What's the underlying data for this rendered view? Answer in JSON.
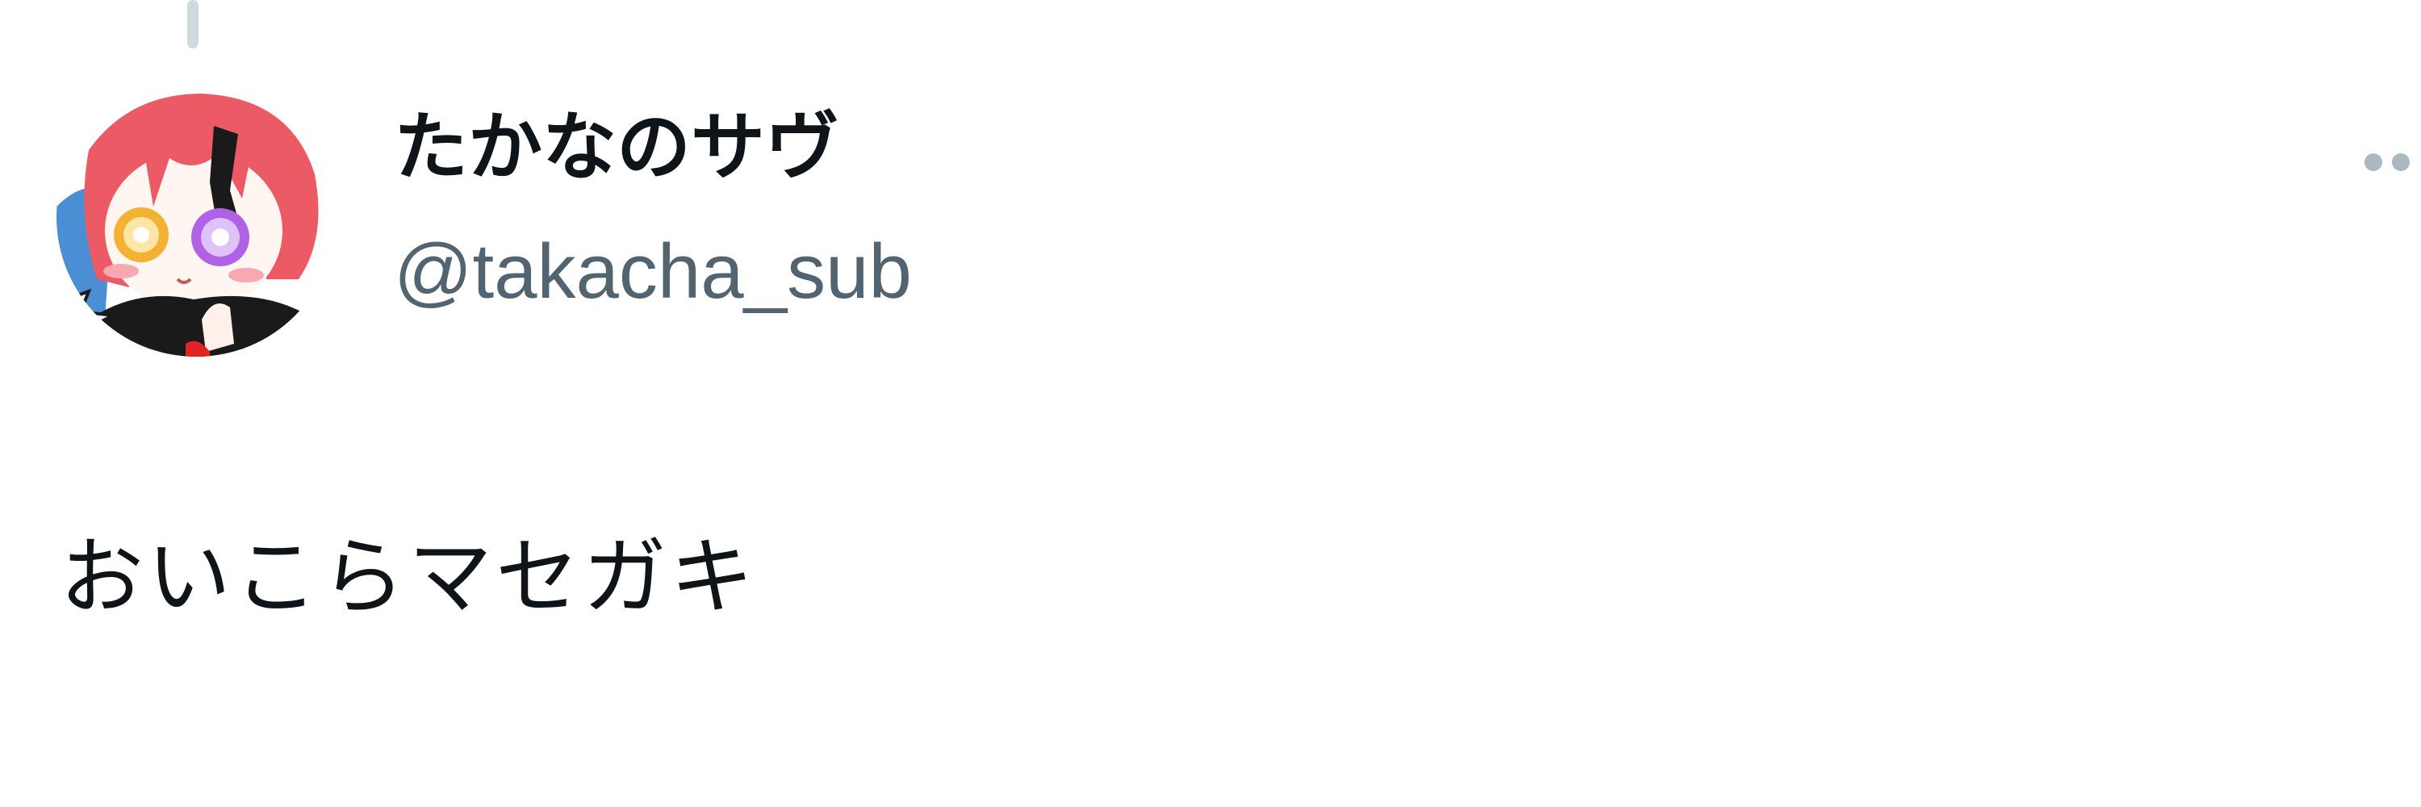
{
  "tweet": {
    "author": {
      "display_name": "たかなのサヴ",
      "handle": "@takacha_sub",
      "avatar_icon": "anime-character-avatar"
    },
    "more_icon": "more-options-icon",
    "text": "おいこらマセガキ"
  },
  "colors": {
    "text_primary": "#0f1419",
    "text_secondary": "#536471",
    "thread_line": "#cfd9de",
    "icon_muted": "#aab8c2",
    "avatar_hair": "#ec5a66"
  }
}
